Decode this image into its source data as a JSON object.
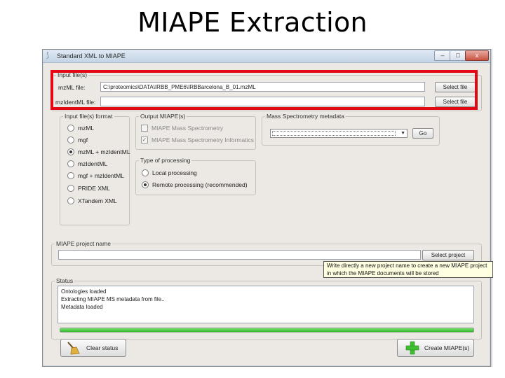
{
  "slide": {
    "title": "MIAPE Extraction"
  },
  "window": {
    "title": "Standard XML to MIAPE",
    "controls": {
      "minimize": "–",
      "maximize": "□",
      "close": "x"
    }
  },
  "input_files": {
    "group_label": "Input file(s)",
    "mzml_label": "mzML file:",
    "mzml_value": "C:\\proteomics\\DATA\\IRBB_PME6\\IRBBarcelona_B_01.mzML",
    "mzidentml_label": "mzIdentML file:",
    "mzidentml_value": "",
    "select_file_1": "Select file",
    "select_file_2": "Select file"
  },
  "input_format": {
    "group_label": "Input file(s) format",
    "options": [
      "mzML",
      "mgf",
      "mzML + mzIdentML",
      "mzIdentML",
      "mgf + mzIdentML",
      "PRIDE XML",
      "XTandem XML"
    ],
    "selected": "mzML + mzIdentML"
  },
  "output_miape": {
    "group_label": "Output MIAPE(s)",
    "options": [
      {
        "label": "MIAPE Mass Spectrometry",
        "checked": false
      },
      {
        "label": "MIAPE Mass Spectrometry Informatics",
        "checked": true
      }
    ]
  },
  "processing": {
    "group_label": "Type of processing",
    "options": [
      "Local processing",
      "Remote processing (recommended)"
    ],
    "selected": "Remote processing (recommended)"
  },
  "ms_metadata": {
    "group_label": "Mass Spectrometry metadata",
    "selected_value": "",
    "go_button": "Go"
  },
  "project": {
    "group_label": "MIAPE project name",
    "value": "",
    "select_button": "Select project",
    "tooltip": "Write directly a new project name to create a new MIAPE project in which the MIAPE documents will be stored"
  },
  "status": {
    "group_label": "Status",
    "lines": [
      "Ontologies loaded",
      "Extracting MIAPE MS metadata from file..",
      "Metadata loaded"
    ],
    "progress_fraction": 1.0,
    "clear_button": "Clear status",
    "create_button": "Create MIAPE(s)"
  },
  "colors": {
    "highlight": "#e30613",
    "progress": "#2eb82a",
    "tooltip_bg": "#ffffe1",
    "create_icon": "#3fbf2f"
  },
  "icons": [
    "app-icon",
    "broom-icon",
    "green-plus-icon",
    "chevron-down-icon"
  ]
}
